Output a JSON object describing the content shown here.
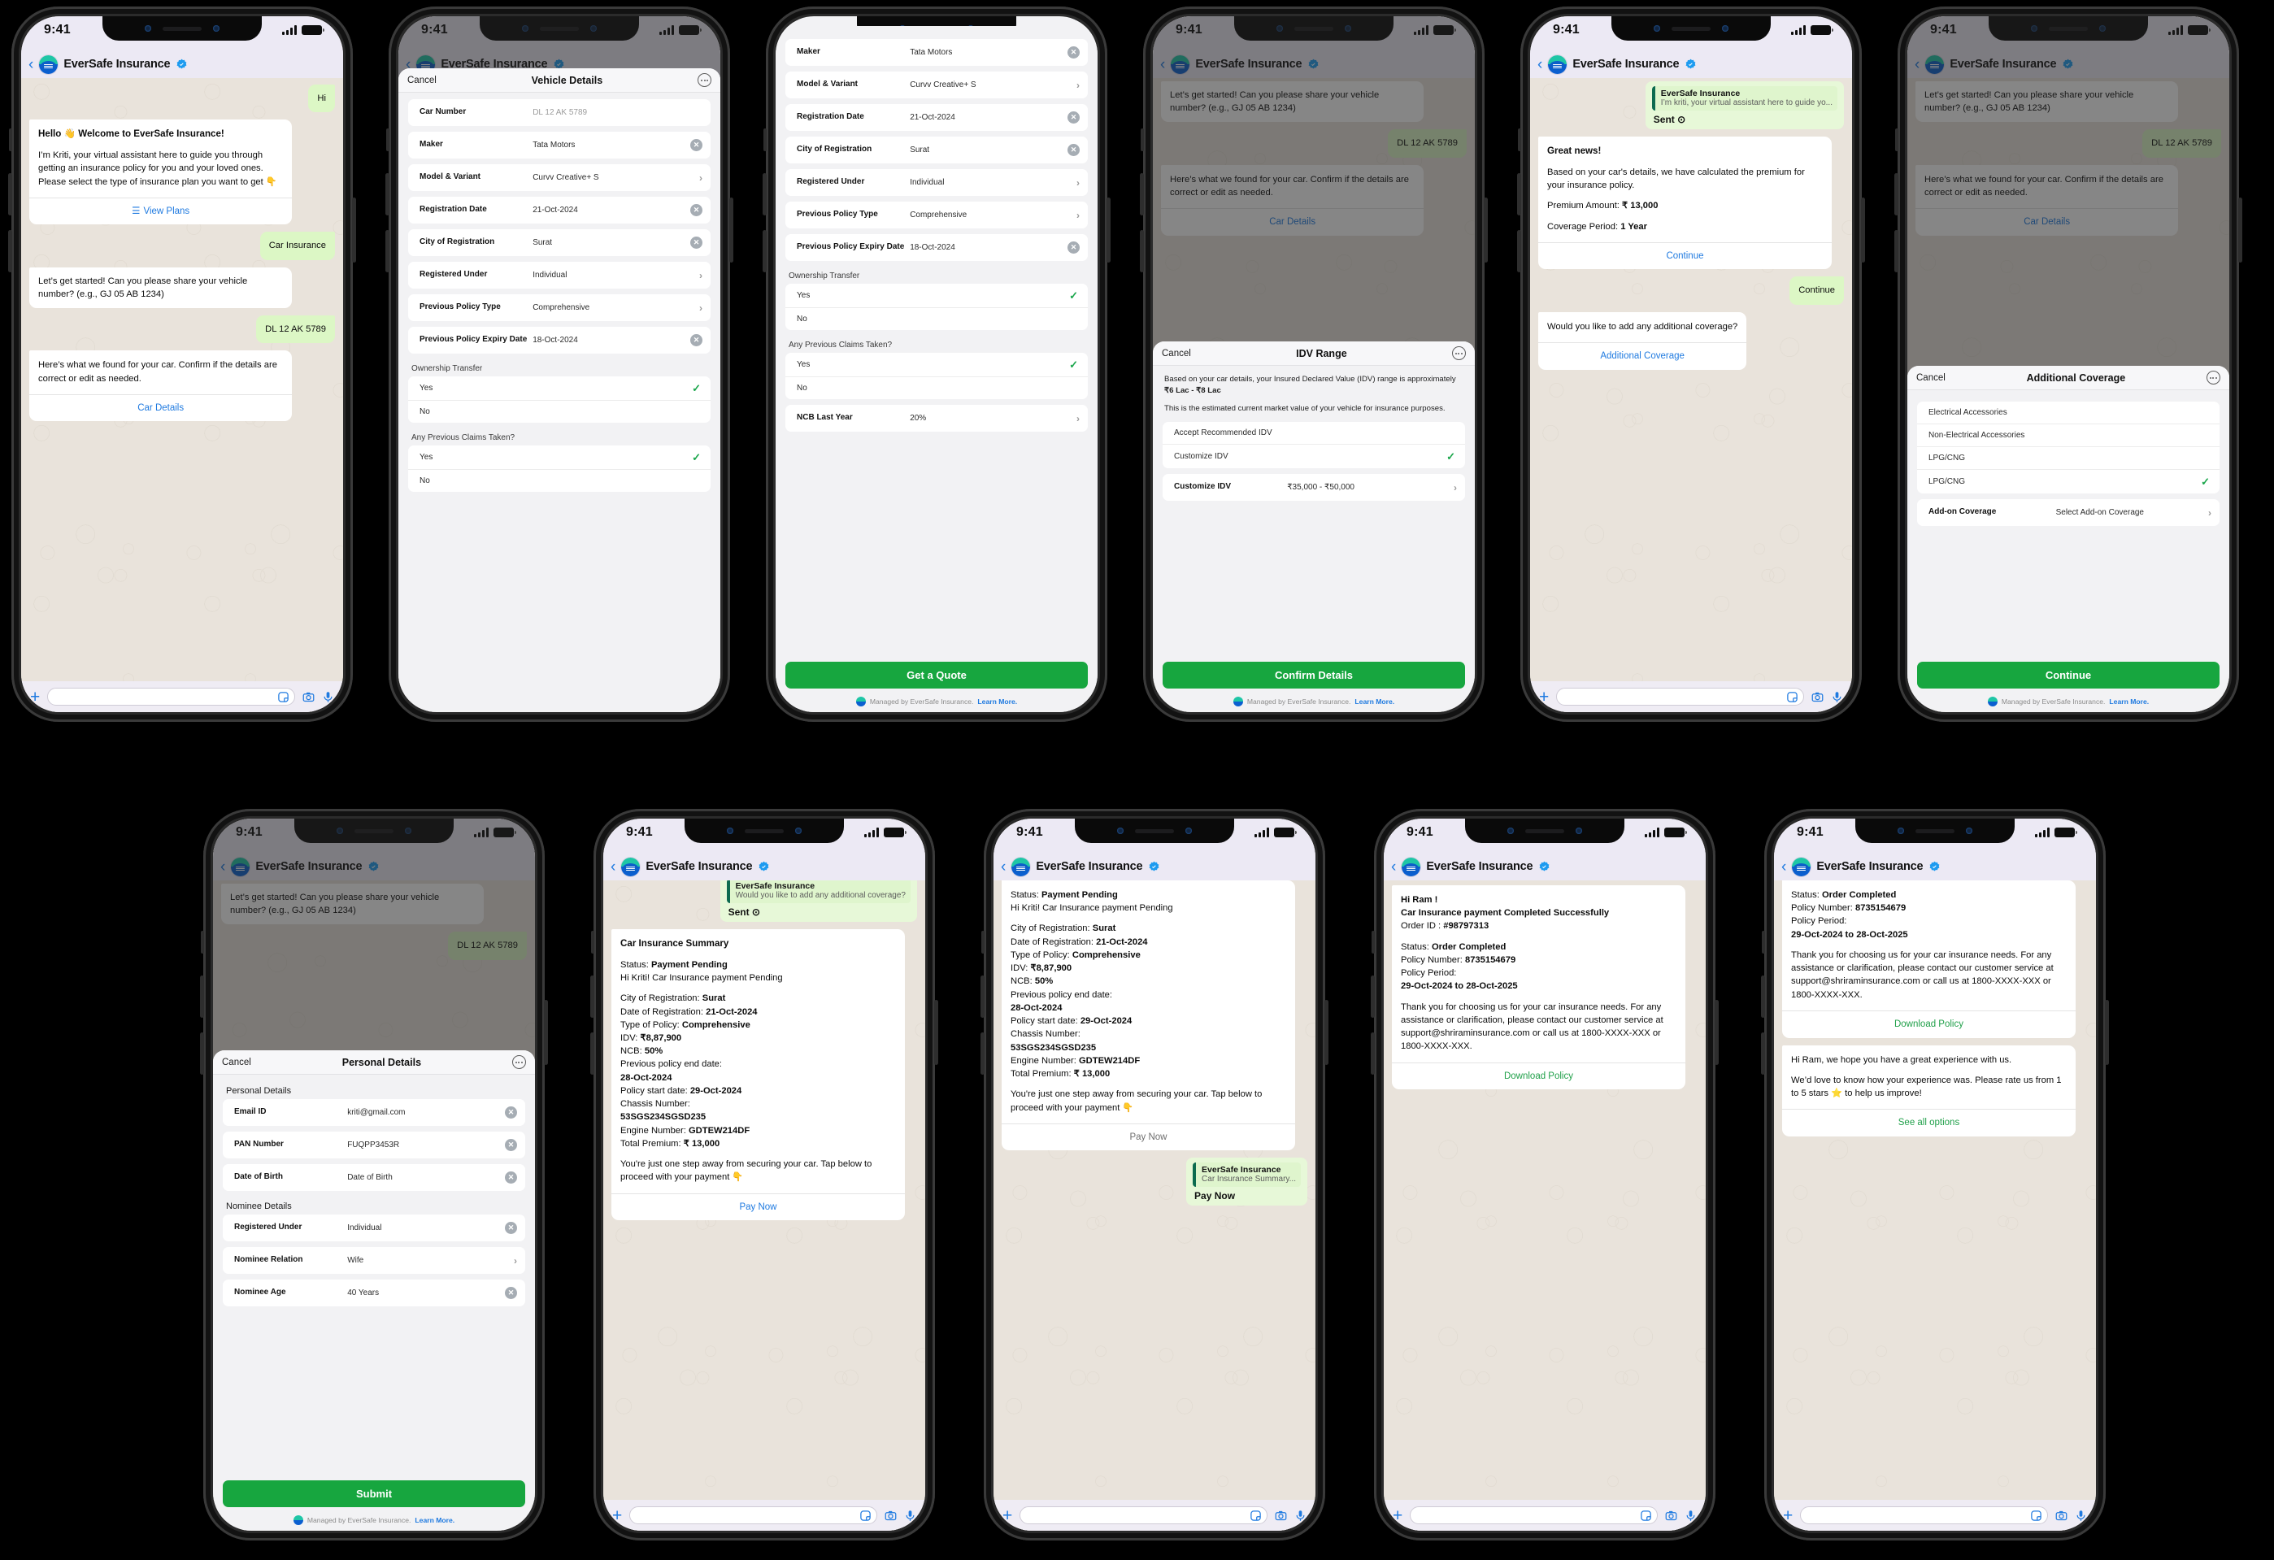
{
  "common": {
    "status_time": "9:41",
    "app_title": "EverSafe Insurance",
    "back_icon": "chevron-left-icon",
    "verified_icon": "verified-badge-icon",
    "logo_icon": "eversafe-logo-icon",
    "plus_icon": "plus-icon",
    "sticker_icon": "sticker-icon",
    "camera_icon": "camera-icon",
    "mic_icon": "microphone-icon",
    "cancel_label": "Cancel",
    "more_icon": "more-options-icon",
    "managed_text": "Managed by EverSafe Insurance.",
    "managed_link": "Learn More.",
    "chevron": "›",
    "clear_x": "✕",
    "check": "✓",
    "accent_green": "#17a63f",
    "accent_blue": "#1f7ae0",
    "bubble_out": "#dcf7c5",
    "chat_bg": "#e9e3db"
  },
  "screen1": {
    "messages": {
      "hi": "Hi",
      "welcome_title": "Hello 👋 Welcome to EverSafe Insurance!",
      "welcome_body": "I’m Kriti, your virtual assistant here to guide you through getting an insurance policy for you and your loved ones. Please select the type of insurance plan you want to get 👇",
      "view_plans": "View Plans",
      "car_insurance": "Car Insurance",
      "get_started": "Let’s get started! Can you please share your vehicle number? (e.g., GJ 05 AB 1234)",
      "vehicle_number": "DL 12 AK 5789",
      "found_car": "Here’s what we found for your car. Confirm if the details are correct or edit as needed.",
      "car_details": "Car Details"
    }
  },
  "screen2": {
    "sheet_title": "Vehicle Details",
    "rows": [
      {
        "key": "Car Number",
        "value": "DL 12 AK 5789",
        "control": "placeholder"
      },
      {
        "key": "Maker",
        "value": "Tata Motors",
        "control": "clear"
      },
      {
        "key": "Model & Variant",
        "value": "Curvv Creative+ S",
        "control": "chevron"
      },
      {
        "key": "Registration Date",
        "value": "21-Oct-2024",
        "control": "clear"
      },
      {
        "key": "City of Registration",
        "value": "Surat",
        "control": "clear"
      },
      {
        "key": "Registered Under",
        "value": "Individual",
        "control": "chevron"
      },
      {
        "key": "Previous Policy Type",
        "value": "Comprehensive",
        "control": "chevron"
      },
      {
        "key": "Previous Policy Expiry Date",
        "value": "18-Oct-2024",
        "control": "clear"
      }
    ],
    "ownership_label": "Ownership Transfer",
    "ownership_options": [
      {
        "label": "Yes",
        "selected": true
      },
      {
        "label": "No",
        "selected": false
      }
    ],
    "claims_label": "Any Previous Claims Taken?",
    "claims_options": [
      {
        "label": "Yes",
        "selected": true
      },
      {
        "label": "No",
        "selected": false
      }
    ]
  },
  "screen3": {
    "rows": [
      {
        "key": "Maker",
        "value": "Tata Motors",
        "control": "clear"
      },
      {
        "key": "Model & Variant",
        "value": "Curvv Creative+ S",
        "control": "chevron"
      },
      {
        "key": "Registration Date",
        "value": "21-Oct-2024",
        "control": "clear"
      },
      {
        "key": "City of Registration",
        "value": "Surat",
        "control": "clear"
      },
      {
        "key": "Registered Under",
        "value": "Individual",
        "control": "chevron"
      },
      {
        "key": "Previous Policy Type",
        "value": "Comprehensive",
        "control": "chevron"
      },
      {
        "key": "Previous Policy Expiry Date",
        "value": "18-Oct-2024",
        "control": "clear"
      }
    ],
    "ownership_label": "Ownership Transfer",
    "ownership_options": [
      {
        "label": "Yes",
        "selected": true
      },
      {
        "label": "No",
        "selected": false
      }
    ],
    "claims_label": "Any Previous Claims Taken?",
    "claims_options": [
      {
        "label": "Yes",
        "selected": true
      },
      {
        "label": "No",
        "selected": false
      }
    ],
    "ncb_key": "NCB Last Year",
    "ncb_value": "20%",
    "submit_label": "Get a Quote"
  },
  "screen4": {
    "sheet_title": "IDV Range",
    "desc_1_pre": "Based on your car details, your Insured Declared Value (IDV) range is approximately ",
    "desc_1_strong": "₹6 Lac - ₹8 Lac",
    "desc_2": "This is the estimated current market value of your vehicle for insurance purposes.",
    "options": [
      {
        "label": "Accept Recommended IDV",
        "selected": false
      },
      {
        "label": "Customize IDV",
        "selected": true
      }
    ],
    "customize_key": "Customize IDV",
    "customize_value": "₹35,000 - ₹50,000",
    "submit_label": "Confirm Details"
  },
  "screen5": {
    "quote_name": "EverSafe Insurance",
    "quote_text": "I’m kriti, your virtual assistant here to guide yo...",
    "quote_reply": "Sent ⊙",
    "great_news_title": "Great news!",
    "great_news_body": "Based on your car's details, we have calculated the premium for your insurance policy.",
    "premium_label": "Premium Amount: ",
    "premium_value": "₹ 13,000",
    "coverage_label": "Coverage Period: ",
    "coverage_value": "1 Year",
    "continue_cta": "Continue",
    "continue_reply": "Continue",
    "additional_q": "Would you like to add any additional coverage?",
    "additional_cta": "Additional Coverage"
  },
  "screen6": {
    "sheet_title": "Additional Coverage",
    "options": [
      {
        "label": "Electrical Accessories",
        "selected": false
      },
      {
        "label": "Non-Electrical Accessories",
        "selected": false
      },
      {
        "label": "LPG/CNG",
        "selected": false
      },
      {
        "label": "LPG/CNG",
        "selected": true
      }
    ],
    "addon_key": "Add-on Coverage",
    "addon_value": "Select Add-on Coverage",
    "submit_label": "Continue"
  },
  "screen7": {
    "sheet_title": "Personal  Details",
    "personal_label": "Personal Details",
    "personal_rows": [
      {
        "key": "Email ID",
        "value": "kriti@gmail.com",
        "control": "clear"
      },
      {
        "key": "PAN Number",
        "value": "FUQPP3453R",
        "control": "clear"
      },
      {
        "key": "Date of Birth",
        "value": "Date of Birth",
        "control": "clear"
      }
    ],
    "nominee_label": "Nominee Details",
    "nominee_rows": [
      {
        "key": "Registered Under",
        "value": "Individual",
        "control": "clear"
      },
      {
        "key": "Nominee Relation",
        "value": "Wife",
        "control": "chevron"
      },
      {
        "key": "Nominee Age",
        "value": "40 Years",
        "control": "clear"
      }
    ],
    "submit_label": "Submit"
  },
  "screen8": {
    "quote_name": "EverSafe Insurance",
    "quote_text": "Would you like to add any additional coverage?",
    "quote_reply": "Sent ⊙",
    "summary_title": "Car Insurance Summary",
    "status_label": "Status: ",
    "status_value": "Payment Pending",
    "greeting": "Hi Kriti! Car Insurance payment Pending",
    "fields": [
      {
        "label": "City of Registration: ",
        "value": "Surat"
      },
      {
        "label": "Date of Registration: ",
        "value": "21-Oct-2024"
      },
      {
        "label": "Type of Policy: ",
        "value": "Comprehensive"
      },
      {
        "label": "IDV: ",
        "value": "₹8,87,900"
      },
      {
        "label": "NCB: ",
        "value": "50%"
      },
      {
        "label": "Previous policy end date: ",
        "value": "28-Oct-2024"
      },
      {
        "label": "Policy start date: ",
        "value": "29-Oct-2024"
      },
      {
        "label": "Chassis Number: ",
        "value": "53SGS234SGSD235"
      },
      {
        "label": "Engine Number: ",
        "value": "GDTEW214DF"
      },
      {
        "label": "Total Premium: ",
        "value": "₹ 13,000"
      }
    ],
    "closing": "You're just one step away from securing your car. Tap below to proceed with your payment 👇",
    "pay_cta": "Pay Now"
  },
  "screen9": {
    "status_label": "Status: ",
    "status_value": "Payment Pending",
    "greeting": "Hi Kriti! Car Insurance payment Pending",
    "fields": [
      {
        "label": "City of Registration: ",
        "value": "Surat"
      },
      {
        "label": "Date of Registration: ",
        "value": "21-Oct-2024"
      },
      {
        "label": "Type of Policy: ",
        "value": "Comprehensive"
      },
      {
        "label": "IDV: ",
        "value": "₹8,87,900"
      },
      {
        "label": "NCB: ",
        "value": "50%"
      },
      {
        "label": "Previous policy end date: ",
        "value": "28-Oct-2024"
      },
      {
        "label": "Policy start date: ",
        "value": "29-Oct-2024"
      },
      {
        "label": "Chassis Number: ",
        "value": "53SGS234SGSD235"
      },
      {
        "label": "Engine Number: ",
        "value": "GDTEW214DF"
      },
      {
        "label": "Total Premium: ",
        "value": "₹ 13,000"
      }
    ],
    "closing": "You're just one step away from securing your car. Tap below to proceed with your payment 👇",
    "pay_cta": "Pay Now",
    "quote_name": "EverSafe Insurance",
    "quote_text": "Car Insurance Summary...",
    "quote_reply": "Pay Now"
  },
  "screen10": {
    "hi_line": "Hi Ram !",
    "completed_line": "Car Insurance payment Completed Successfully",
    "order_label": "Order ID : ",
    "order_value": "#98797313",
    "status_label": "Status: ",
    "status_value": "Order Completed",
    "policy_no_label": "Policy Number: ",
    "policy_no_value": "8735154679",
    "policy_period_label": "Policy Period:",
    "policy_period_value": "29-Oct-2024 to 28-Oct-2025",
    "thanks": "Thank you for choosing us for your car insurance needs. For any assistance or clarification, please contact our customer service at support@shriraminsurance.com or call us at 1800-XXXX-XXX or 1800-XXXX-XXX.",
    "download_cta": "Download Policy"
  },
  "screen11": {
    "status_label": "Status: ",
    "status_value": "Order Completed",
    "policy_no_label": "Policy Number: ",
    "policy_no_value": "8735154679",
    "policy_period_label": "Policy Period:",
    "policy_period_value": "29-Oct-2024 to 28-Oct-2025",
    "thanks": "Thank you for choosing us for your car insurance needs. For any assistance or clarification, please contact our customer service at support@shriraminsurance.com or call us at 1800-XXXX-XXX or 1800-XXXX-XXX.",
    "download_cta": "Download Policy",
    "rate_line1": "Hi Ram, we hope you have a great experience with us.",
    "rate_line2": "We’d love to know how your experience was. Please rate us from 1 to 5 stars ⭐ to help us improve!",
    "see_all_cta": "See all options"
  }
}
